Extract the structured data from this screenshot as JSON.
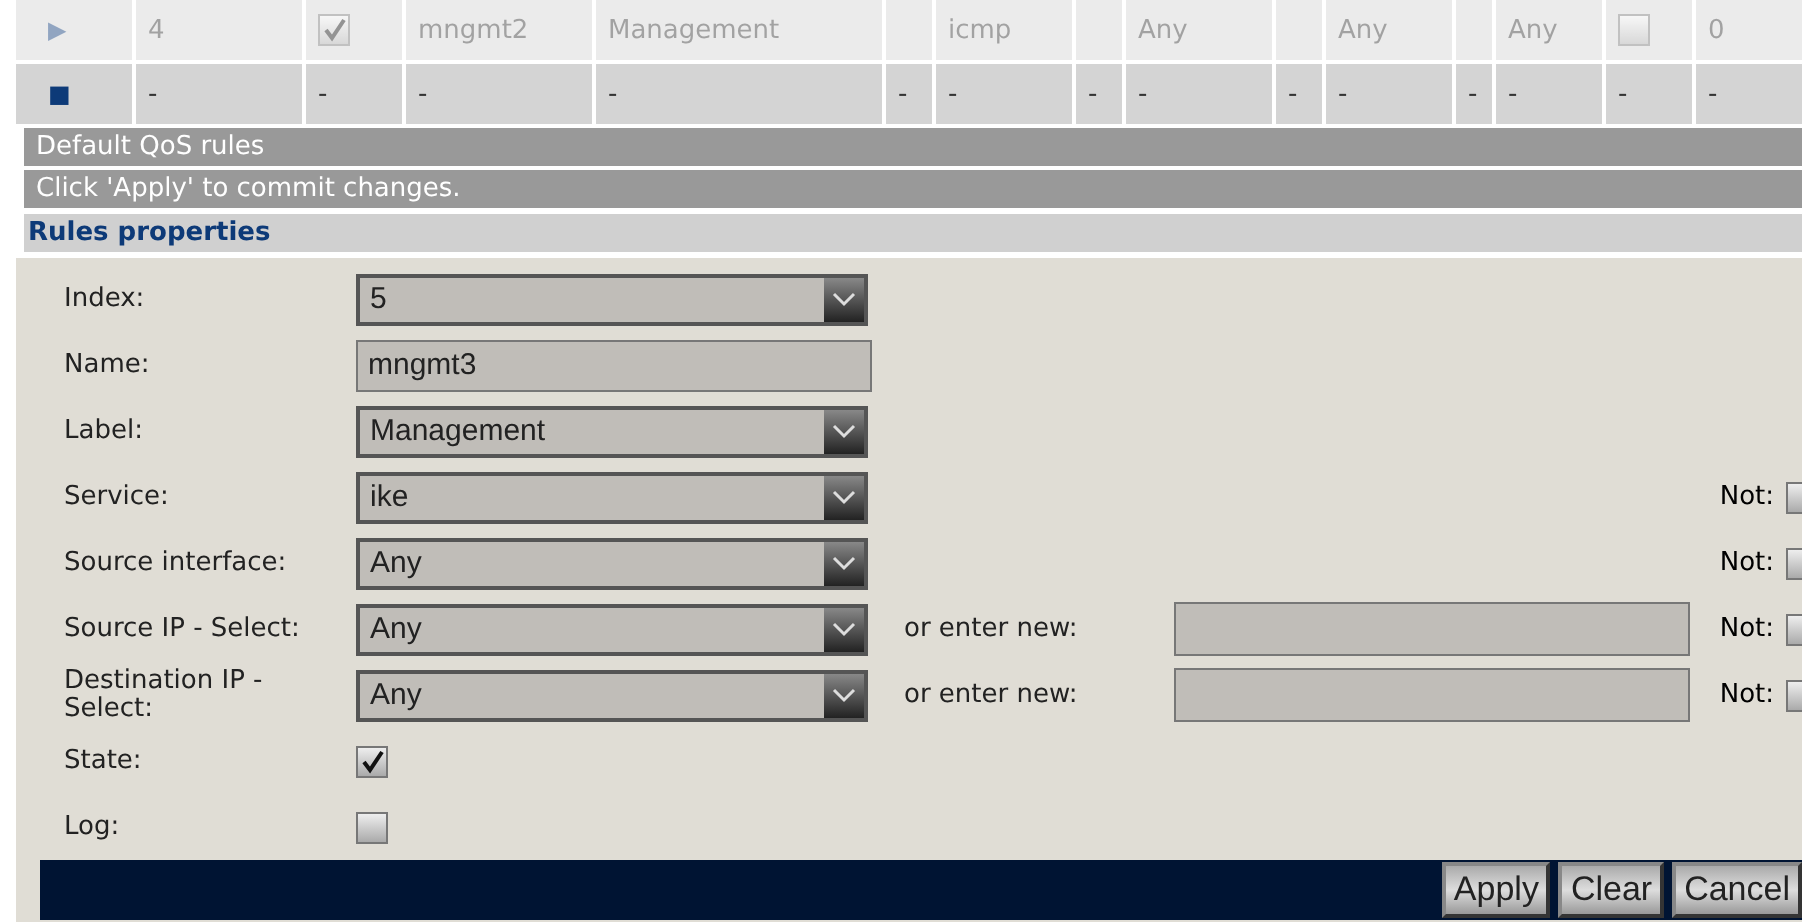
{
  "table": {
    "rows": [
      {
        "dimmed": true,
        "marker": "▶",
        "cells": [
          {
            "kind": "text",
            "text": "4"
          },
          {
            "kind": "check",
            "checked": true
          },
          {
            "kind": "text",
            "text": "mngmt2"
          },
          {
            "kind": "text",
            "text": "Management"
          },
          {
            "kind": "empty"
          },
          {
            "kind": "text",
            "text": "icmp"
          },
          {
            "kind": "empty"
          },
          {
            "kind": "text",
            "text": "Any"
          },
          {
            "kind": "empty"
          },
          {
            "kind": "text",
            "text": "Any"
          },
          {
            "kind": "empty"
          },
          {
            "kind": "text",
            "text": "Any"
          },
          {
            "kind": "check",
            "checked": false
          },
          {
            "kind": "text",
            "text": "0"
          }
        ]
      },
      {
        "dimmed": false,
        "marker": "■",
        "cells": [
          {
            "kind": "text",
            "text": "-"
          },
          {
            "kind": "text",
            "text": "-"
          },
          {
            "kind": "text",
            "text": "-"
          },
          {
            "kind": "text",
            "text": "-"
          },
          {
            "kind": "text",
            "text": "-"
          },
          {
            "kind": "text",
            "text": "-"
          },
          {
            "kind": "text",
            "text": "-"
          },
          {
            "kind": "text",
            "text": "-"
          },
          {
            "kind": "text",
            "text": "-"
          },
          {
            "kind": "text",
            "text": "-"
          },
          {
            "kind": "text",
            "text": "-"
          },
          {
            "kind": "text",
            "text": "-"
          },
          {
            "kind": "text",
            "text": "-"
          },
          {
            "kind": "text",
            "text": "-"
          }
        ]
      }
    ]
  },
  "bars": [
    "Default QoS rules",
    "Click 'Apply' to commit changes."
  ],
  "section_title": "Rules properties",
  "fields": [
    {
      "kind": "select",
      "label": "Index:",
      "value": "5"
    },
    {
      "kind": "text",
      "label": "Name:",
      "value": "mngmt3"
    },
    {
      "kind": "select",
      "label": "Label:",
      "value": "Management"
    },
    {
      "kind": "select",
      "label": "Service:",
      "value": "ike",
      "not_label": "Not:",
      "not_checked": false
    },
    {
      "kind": "select",
      "label": "Source interface:",
      "value": "Any",
      "not_label": "Not:",
      "not_checked": false
    },
    {
      "kind": "select",
      "label": "Source IP - Select:",
      "value": "Any",
      "extra_label": "or enter new:",
      "not_label": "Not:",
      "not_checked": false
    },
    {
      "kind": "select",
      "label": "Destination IP - Select:",
      "value": "Any",
      "extra_label": "or enter new:",
      "not_label": "Not:",
      "not_checked": false
    },
    {
      "kind": "checkbox",
      "label": "State:",
      "checked": true
    },
    {
      "kind": "checkbox",
      "label": "Log:",
      "checked": false
    }
  ],
  "buttons": [
    "Apply",
    "Clear",
    "Cancel"
  ]
}
